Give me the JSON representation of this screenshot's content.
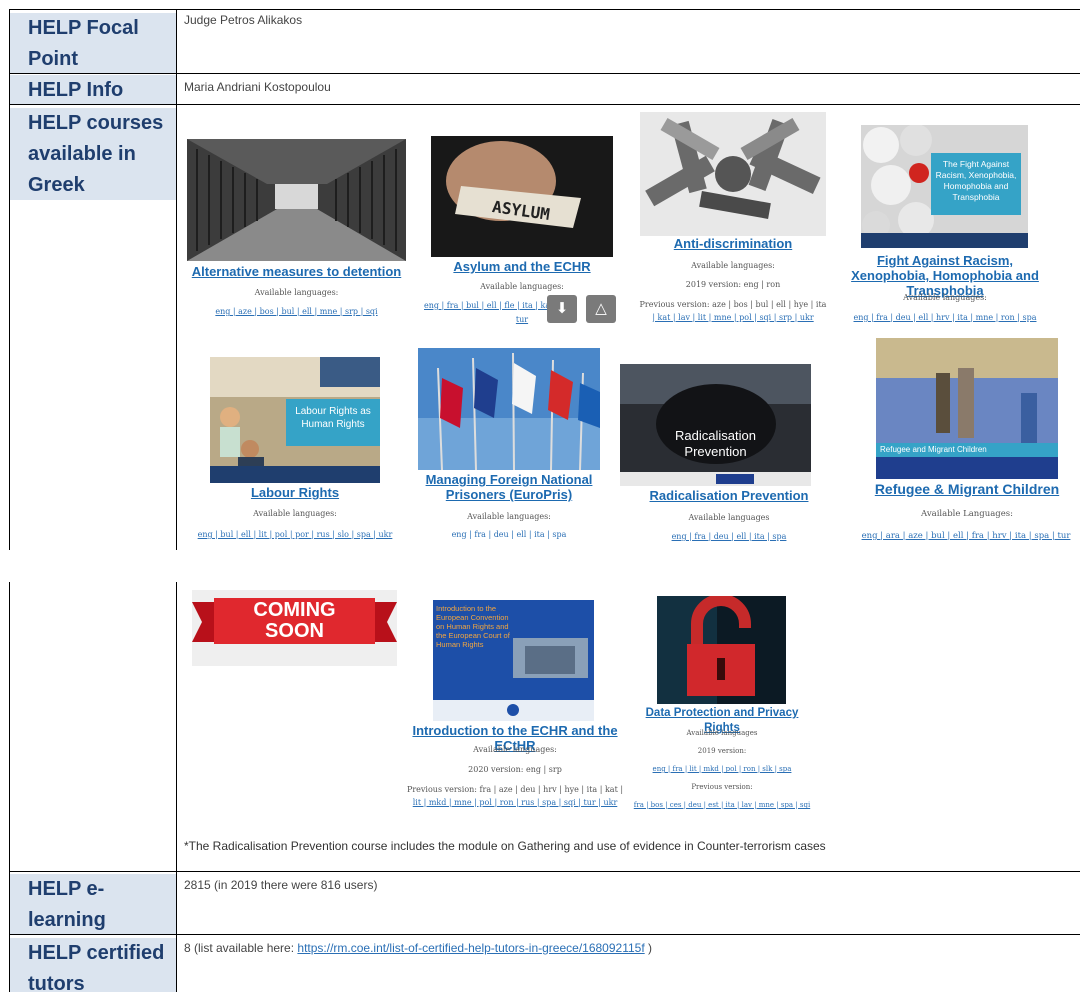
{
  "rows": {
    "focal": {
      "header": "HELP Focal Point",
      "value": "Judge Petros Alikakos"
    },
    "info": {
      "header": "HELP Info Point",
      "value": "Maria Andriani Kostopoulou"
    },
    "courses": {
      "header": "HELP courses available in Greek"
    },
    "users": {
      "header": "HELP e-learning platform users",
      "value": "2815 (in 2019 there were 816 users)"
    },
    "tutors": {
      "header": "HELP certified tutors",
      "value_prefix": "8 (list available here: ",
      "link": "https://rm.coe.int/list-of-certified-help-tutors-in-greece/168092115f",
      "value_suffix": " )"
    }
  },
  "courses": [
    {
      "title": "Alternative measures to detention",
      "line1": "Available languages:",
      "line2": "eng | aze | bos | bul | ell | mne | srp | sqi"
    },
    {
      "title": "Asylum and the ECHR",
      "image_text": "ASYLUM",
      "line1": "Available languages:",
      "line2": "eng | fra | bul | ell | fle | ita | kat | ... |",
      "line3": "tur"
    },
    {
      "title": "Anti-discrimination",
      "line1": "Available languages:",
      "line2": "2019 version: eng | ron",
      "line3": "Previous version: aze | bos | bul | ell | hye | ita",
      "line4": "| kat | lav | lit | mne | pol | sqi | srp | ukr"
    },
    {
      "title": "Fight Against Racism, Xenophobia, Homophobia and Transphobia",
      "image_text": "The Fight Against Racism, Xenophobia, Homophobia and Transphobia",
      "line1": "Available languages:",
      "line2": "eng | fra | deu | ell | hrv | ita | mne | ron | spa"
    },
    {
      "title": "Labour Rights",
      "image_text": "Labour Rights as Human Rights",
      "line1": "Available languages:",
      "line2": "eng | bul | ell | lit | pol | por | rus | slo | spa | ukr"
    },
    {
      "title": "Managing Foreign National Prisoners (EuroPris)",
      "line1": "Available languages:",
      "line2": "eng | fra | deu | ell | ita | spa"
    },
    {
      "title": "Radicalisation Prevention",
      "image_text": "Radicalisation Prevention",
      "line1": "Available languages",
      "line2": "eng | fra | deu | ell | ita | spa"
    },
    {
      "title": "Refugee & Migrant Children",
      "image_text": "Refugee and Migrant Children",
      "line1": "Available Languages:",
      "line2": "eng | ara | aze | bul | ell | fra | hrv | ita | spa | tur"
    }
  ],
  "coming_soon": {
    "badge": "COMING SOON",
    "items": [
      {
        "title": "Introduction to the ECHR and the ECtHR",
        "image_text": "Introduction to the European Convention on Human Rights and the European Court of Human Rights",
        "line1": "Available languages:",
        "line2": "2020 version: eng | srp",
        "line3": "Previous version: fra | aze | deu | hrv | hye | ita | kat |",
        "line4": "lit | mkd | mne | pol | ron | rus | spa | sqi | tur | ukr"
      },
      {
        "title": "Data Protection and Privacy Rights",
        "line1": "Available languages",
        "line2": "2019 version:",
        "line3": "eng | fra | lit | mkd | pol | ron | slk | spa",
        "line4": "Previous version:",
        "line5": "fra | bos | ces | deu | est | ita | lav | mne | spa | sqi"
      }
    ]
  },
  "note": "*The Radicalisation Prevention course includes the module on Gathering and use of evidence in Counter-terrorism cases",
  "icons": {
    "download": "download-icon",
    "drive": "drive-icon"
  },
  "colors": {
    "header_bg": "#dbe4ef",
    "header_text": "#1f3e6e",
    "link": "#1d6ab0"
  }
}
